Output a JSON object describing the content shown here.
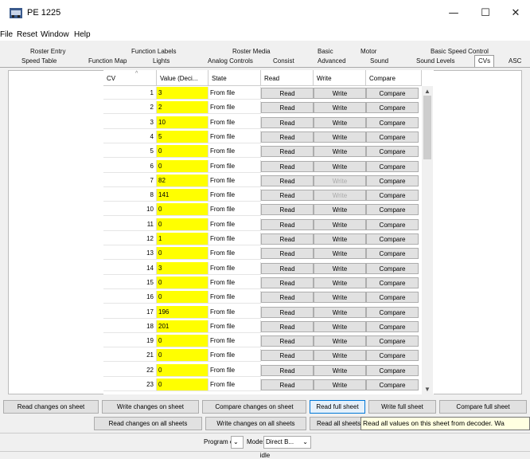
{
  "window": {
    "title": "PE 1225",
    "minimize": "—",
    "maximize": "☐",
    "close": "✕"
  },
  "menu": [
    "File",
    "Reset",
    "Window",
    "Help"
  ],
  "tabs_row1": [
    "Roster Entry",
    "Function Labels",
    "Roster Media",
    "Basic",
    "Motor",
    "Basic Speed Control"
  ],
  "tabs_row2": [
    "Speed Table",
    "Function Map",
    "Lights",
    "Analog Controls",
    "Consist",
    "Advanced",
    "Sound",
    "Sound Levels",
    "CVs",
    "ASC"
  ],
  "table": {
    "headers": [
      "CV",
      "Value (Deci...",
      "State",
      "Read",
      "Write",
      "Compare"
    ],
    "read_label": "Read",
    "write_label": "Write",
    "compare_label": "Compare",
    "rows": [
      {
        "cv": "1",
        "value": "3",
        "state": "From file"
      },
      {
        "cv": "2",
        "value": "2",
        "state": "From file"
      },
      {
        "cv": "3",
        "value": "10",
        "state": "From file"
      },
      {
        "cv": "4",
        "value": "5",
        "state": "From file"
      },
      {
        "cv": "5",
        "value": "0",
        "state": "From file"
      },
      {
        "cv": "6",
        "value": "0",
        "state": "From file"
      },
      {
        "cv": "7",
        "value": "82",
        "state": "From file"
      },
      {
        "cv": "8",
        "value": "141",
        "state": "From file"
      },
      {
        "cv": "10",
        "value": "0",
        "state": "From file"
      },
      {
        "cv": "11",
        "value": "0",
        "state": "From file"
      },
      {
        "cv": "12",
        "value": "1",
        "state": "From file"
      },
      {
        "cv": "13",
        "value": "0",
        "state": "From file"
      },
      {
        "cv": "14",
        "value": "3",
        "state": "From file"
      },
      {
        "cv": "15",
        "value": "0",
        "state": "From file"
      },
      {
        "cv": "16",
        "value": "0",
        "state": "From file"
      },
      {
        "cv": "17",
        "value": "196",
        "state": "From file"
      },
      {
        "cv": "18",
        "value": "201",
        "state": "From file"
      },
      {
        "cv": "19",
        "value": "0",
        "state": "From file"
      },
      {
        "cv": "21",
        "value": "0",
        "state": "From file"
      },
      {
        "cv": "22",
        "value": "0",
        "state": "From file"
      },
      {
        "cv": "23",
        "value": "0",
        "state": "From file"
      }
    ],
    "write_disabled_cvs": [
      "7",
      "8"
    ]
  },
  "buttons_row1": [
    "Read changes on sheet",
    "Write changes on sheet",
    "Compare changes on sheet",
    "Read full sheet",
    "Write full sheet",
    "Compare full sheet"
  ],
  "buttons_row2": [
    "Read changes on all sheets",
    "Write changes on all sheets",
    "Read all sheets"
  ],
  "tooltip": "Read all values on this sheet from decoder. Wa",
  "programming": {
    "program_on_label": "Program on:",
    "mode_label": "Mode:",
    "mode_value": "Direct B..."
  },
  "status": "idle",
  "colors": {
    "value_cell": "#ffff00",
    "tooltip_bg": "#ffffe1"
  }
}
